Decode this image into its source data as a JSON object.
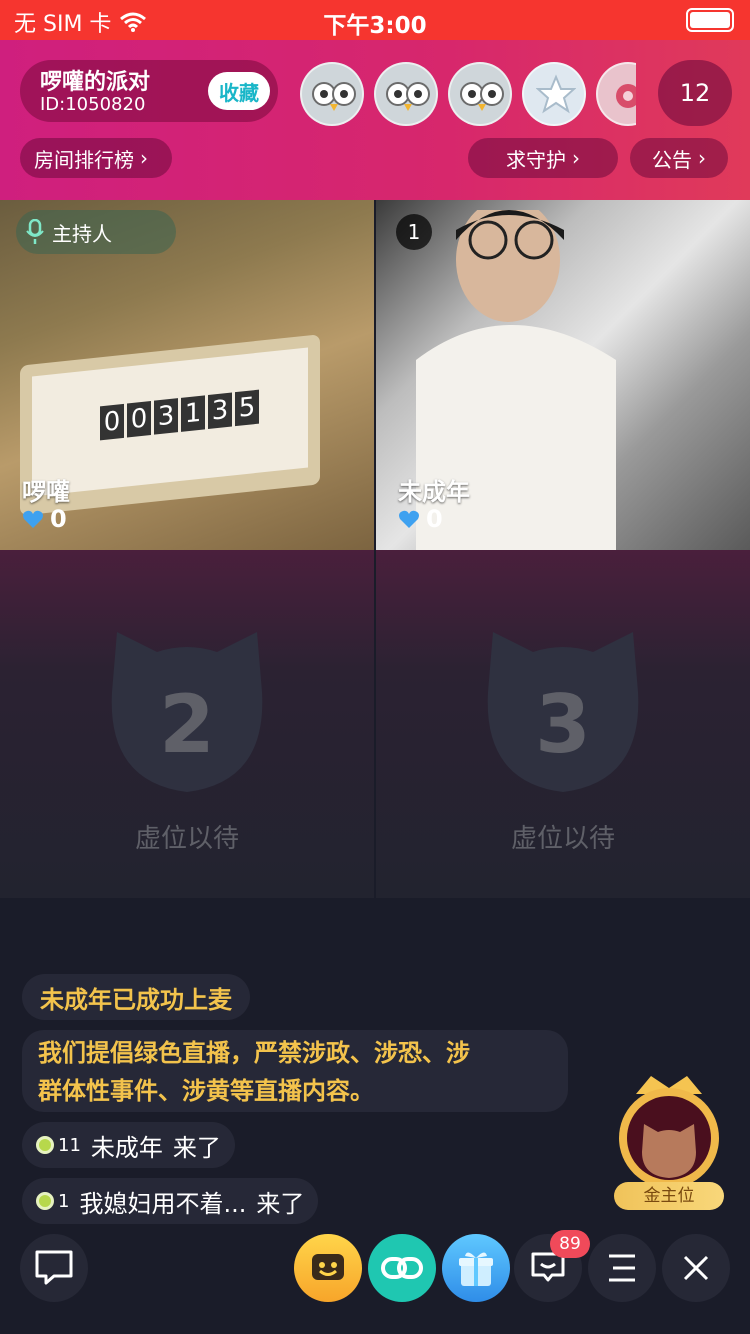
{
  "status_bar": {
    "carrier": "无 SIM 卡",
    "time": "下午3:00"
  },
  "room": {
    "name": "啰嚾的派对",
    "id_text": "ID:1050820",
    "favorite_label": "收藏",
    "online_count": "12",
    "ranking_label": "房间排行榜",
    "guard_label": "求守护",
    "notice_label": "公告"
  },
  "seats": [
    {
      "host_tag": "主持人",
      "name": "啰嚾",
      "score": "0"
    },
    {
      "position": "1",
      "name": "未成年",
      "score": "0"
    },
    {
      "position": "2",
      "empty_text": "虚位以待"
    },
    {
      "position": "3",
      "empty_text": "虚位以待"
    }
  ],
  "timer_digits": [
    "0",
    "0",
    "3",
    "1",
    "3",
    "5"
  ],
  "chat": {
    "system_msg": "未成年已成功上麦",
    "notice_line1": "我们提倡绿色直播，严禁涉政、涉恐、涉",
    "notice_line2": "群体性事件、涉黄等直播内容。",
    "joins": [
      {
        "level": "11",
        "user": "未成年",
        "action": "来了"
      },
      {
        "level": "1",
        "user": "我媳妇用不着...",
        "action": "来了"
      }
    ]
  },
  "gold_seat_label": "金主位",
  "bottom_bar": {
    "message_badge": "89",
    "icons": [
      "chat-bubble-icon",
      "emoji-icon",
      "link-icon",
      "gift-icon",
      "message-icon",
      "menu-icon",
      "close-icon"
    ]
  },
  "colors": {
    "status_bar": "#f6352f",
    "header": "#d7276c",
    "accent_gold": "#f3c34c",
    "fav_text": "#19b6c8",
    "background": "#1a1c29"
  }
}
